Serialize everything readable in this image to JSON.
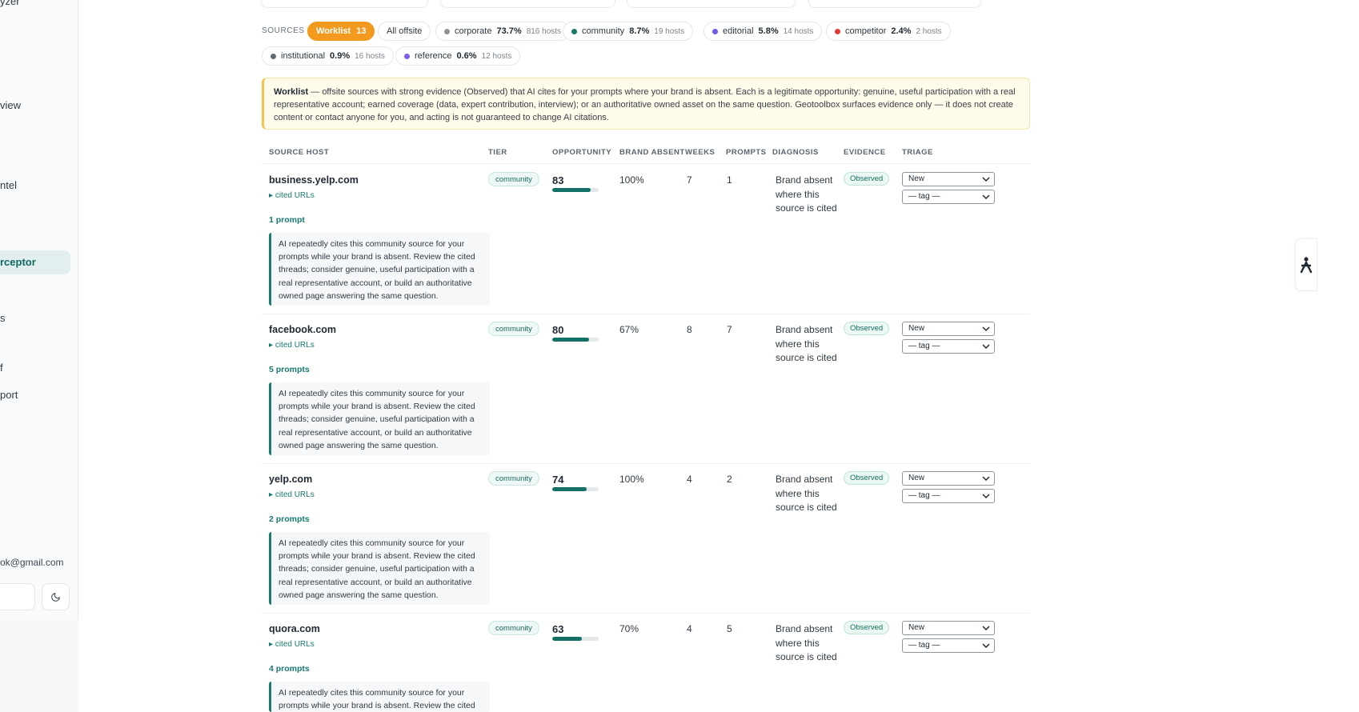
{
  "sidebar": {
    "items": [
      {
        "label": "yzer"
      },
      {
        "label": "view"
      },
      {
        "label": "ntel"
      },
      {
        "label": "rceptor"
      },
      {
        "label": "s"
      },
      {
        "label": "f"
      },
      {
        "label": "port"
      }
    ],
    "email": "ok@gmail.com",
    "theme_icon": "moon-icon"
  },
  "sources": {
    "label": "SOURCES",
    "worklist": {
      "label": "Worklist",
      "count": "13"
    },
    "all_offsite": "All offsite",
    "chips": [
      {
        "name": "corporate",
        "pct": "73.7%",
        "hosts": "816 hosts",
        "color": "#8c939a"
      },
      {
        "name": "community",
        "pct": "8.7%",
        "hosts": "19 hosts",
        "color": "#1a7a6e"
      },
      {
        "name": "editorial",
        "pct": "5.8%",
        "hosts": "14 hosts",
        "color": "#6c5ce7"
      },
      {
        "name": "competitor",
        "pct": "2.4%",
        "hosts": "2 hosts",
        "color": "#e53935"
      },
      {
        "name": "institutional",
        "pct": "0.9%",
        "hosts": "16 hosts",
        "color": "#5f6a73"
      },
      {
        "name": "reference",
        "pct": "0.6%",
        "hosts": "12 hosts",
        "color": "#7c5ce8"
      }
    ]
  },
  "notice": {
    "title": "Worklist",
    "text": " — offsite sources with strong evidence (Observed) that AI cites for your prompts where your brand is absent. Each is a legitimate opportunity: genuine, useful participation with a real representative account; earned coverage (data, expert contribution, interview); or an authoritative owned asset on the same question. Geotoolbox surfaces evidence only — it does not create content or contact anyone for you, and acting is not guaranteed to change AI citations."
  },
  "table": {
    "headers": {
      "host": "SOURCE HOST",
      "tier": "TIER",
      "opportunity": "OPPORTUNITY",
      "brand_absent": "BRAND ABSENT",
      "weeks": "WEEKS",
      "prompts": "PROMPTS",
      "diagnosis": "DIAGNOSIS",
      "evidence": "EVIDENCE",
      "triage": "TRIAGE"
    },
    "rows": [
      {
        "host": "business.yelp.com",
        "cited": "cited URLs",
        "prompts_link": "1 prompt",
        "quote": "AI repeatedly cites this community source for your prompts while your brand is absent. Review the cited threads; consider genuine, useful participation with a real representative account, or build an authoritative owned page answering the same question.",
        "tier": "community",
        "opportunity": "83",
        "opportunity_fill": 0.83,
        "brand_absent": "100%",
        "weeks": "7",
        "prompts": "1",
        "diagnosis": "Brand absent where this source is cited",
        "evidence": "Observed",
        "status": "New",
        "tag": "— tag —"
      },
      {
        "host": "facebook.com",
        "cited": "cited URLs",
        "prompts_link": "5 prompts",
        "quote": "AI repeatedly cites this community source for your prompts while your brand is absent. Review the cited threads; consider genuine, useful participation with a real representative account, or build an authoritative owned page answering the same question.",
        "tier": "community",
        "opportunity": "80",
        "opportunity_fill": 0.8,
        "brand_absent": "67%",
        "weeks": "8",
        "prompts": "7",
        "diagnosis": "Brand absent where this source is cited",
        "evidence": "Observed",
        "status": "New",
        "tag": "— tag —"
      },
      {
        "host": "yelp.com",
        "cited": "cited URLs",
        "prompts_link": "2 prompts",
        "quote": "AI repeatedly cites this community source for your prompts while your brand is absent. Review the cited threads; consider genuine, useful participation with a real representative account, or build an authoritative owned page answering the same question.",
        "tier": "community",
        "opportunity": "74",
        "opportunity_fill": 0.74,
        "brand_absent": "100%",
        "weeks": "4",
        "prompts": "2",
        "diagnosis": "Brand absent where this source is cited",
        "evidence": "Observed",
        "status": "New",
        "tag": "— tag —"
      },
      {
        "host": "quora.com",
        "cited": "cited URLs",
        "prompts_link": "4 prompts",
        "quote": "AI repeatedly cites this community source for your prompts while your brand is absent. Review the cited threads; consider genuine, useful participation with a real representative account, or build an authoritative owned page answering the same question.",
        "tier": "community",
        "opportunity": "63",
        "opportunity_fill": 0.63,
        "brand_absent": "70%",
        "weeks": "4",
        "prompts": "5",
        "diagnosis": "Brand absent where this source is cited",
        "evidence": "Observed",
        "status": "New",
        "tag": "— tag —"
      }
    ]
  },
  "floating_button_icon": "accessibility-person-icon"
}
